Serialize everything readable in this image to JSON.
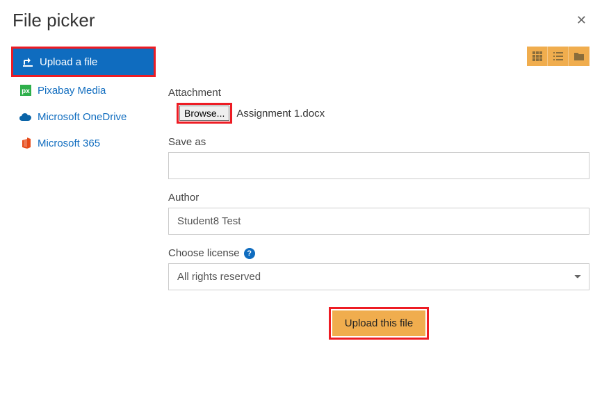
{
  "header": {
    "title": "File picker"
  },
  "sidebar": {
    "items": [
      {
        "label": "Upload a file"
      },
      {
        "label": "Pixabay Media"
      },
      {
        "label": "Microsoft OneDrive"
      },
      {
        "label": "Microsoft 365"
      }
    ]
  },
  "form": {
    "attachment_label": "Attachment",
    "browse_label": "Browse...",
    "filename": "Assignment 1.docx",
    "save_as_label": "Save as",
    "save_as_value": "",
    "author_label": "Author",
    "author_value": "Student8 Test",
    "license_label": "Choose license",
    "license_value": "All rights reserved",
    "license_options": [
      "All rights reserved"
    ],
    "submit_label": "Upload this file"
  }
}
